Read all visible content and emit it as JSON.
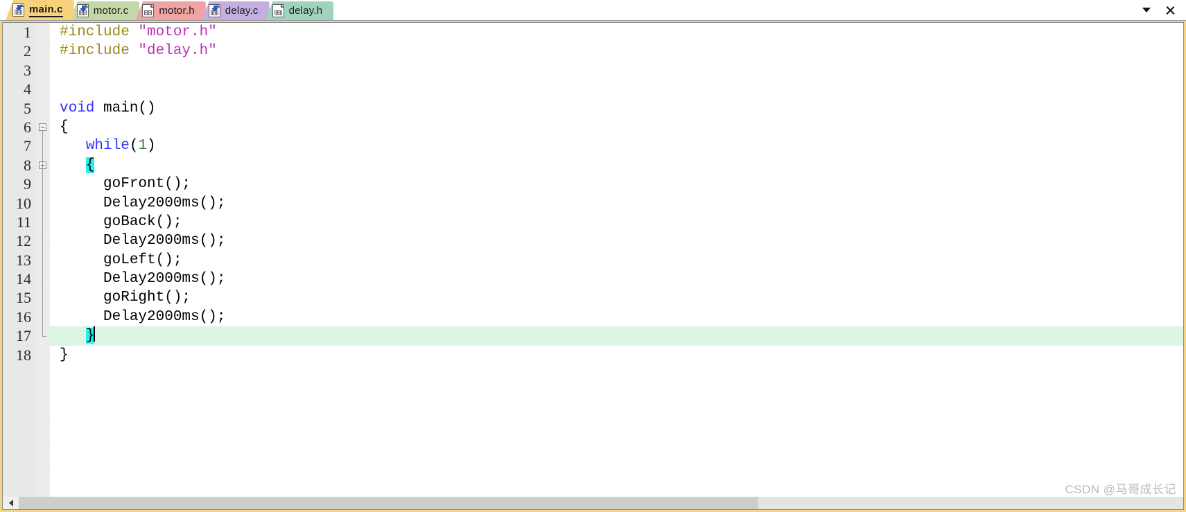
{
  "window": {
    "dropdown_icon": "chevron-down-icon",
    "close_icon": "close-icon"
  },
  "tabs": [
    {
      "label": "main.c",
      "icon": "c-file-icon",
      "active": true,
      "bg": "#f7d27a",
      "has_arrow": true
    },
    {
      "label": "motor.c",
      "icon": "c-file-icon",
      "active": false,
      "bg": "#c3d8a8",
      "has_arrow": true
    },
    {
      "label": "motor.h",
      "icon": "h-file-icon",
      "active": false,
      "bg": "#efa3a3",
      "has_arrow": false
    },
    {
      "label": "delay.c",
      "icon": "c-file-icon",
      "active": false,
      "bg": "#c4aee0",
      "has_arrow": true
    },
    {
      "label": "delay.h",
      "icon": "h-file-icon",
      "active": false,
      "bg": "#9fd3bd",
      "has_arrow": false
    }
  ],
  "editor": {
    "current_line": 17,
    "line_numbers": [
      1,
      2,
      3,
      4,
      5,
      6,
      7,
      8,
      9,
      10,
      11,
      12,
      13,
      14,
      15,
      16,
      17,
      18
    ],
    "lines": [
      {
        "n": 1,
        "tokens": [
          {
            "t": "#include ",
            "c": "tk-pre"
          },
          {
            "t": "\"motor.h\"",
            "c": "tk-str"
          }
        ]
      },
      {
        "n": 2,
        "tokens": [
          {
            "t": "#include ",
            "c": "tk-pre"
          },
          {
            "t": "\"delay.h\"",
            "c": "tk-str"
          }
        ]
      },
      {
        "n": 3,
        "tokens": []
      },
      {
        "n": 4,
        "tokens": []
      },
      {
        "n": 5,
        "tokens": [
          {
            "t": "void",
            "c": "tk-kw"
          },
          {
            "t": " main()",
            "c": "tk-plain"
          }
        ]
      },
      {
        "n": 6,
        "tokens": [
          {
            "t": "{",
            "c": "tk-brace"
          }
        ]
      },
      {
        "n": 7,
        "tokens": [
          {
            "t": "   ",
            "c": "tk-plain"
          },
          {
            "t": "while",
            "c": "tk-kw"
          },
          {
            "t": "(",
            "c": "tk-plain"
          },
          {
            "t": "1",
            "c": "tk-num"
          },
          {
            "t": ")",
            "c": "tk-plain"
          }
        ]
      },
      {
        "n": 8,
        "tokens": [
          {
            "t": "   ",
            "c": "tk-plain"
          },
          {
            "t": "{",
            "c": "hl-match"
          }
        ]
      },
      {
        "n": 9,
        "tokens": [
          {
            "t": "     goFront();",
            "c": "tk-plain"
          }
        ]
      },
      {
        "n": 10,
        "tokens": [
          {
            "t": "     Delay2000ms();",
            "c": "tk-plain"
          }
        ]
      },
      {
        "n": 11,
        "tokens": [
          {
            "t": "     goBack();",
            "c": "tk-plain"
          }
        ]
      },
      {
        "n": 12,
        "tokens": [
          {
            "t": "     Delay2000ms();",
            "c": "tk-plain"
          }
        ]
      },
      {
        "n": 13,
        "tokens": [
          {
            "t": "     goLeft();",
            "c": "tk-plain"
          }
        ]
      },
      {
        "n": 14,
        "tokens": [
          {
            "t": "     Delay2000ms();",
            "c": "tk-plain"
          }
        ]
      },
      {
        "n": 15,
        "tokens": [
          {
            "t": "     goRight();",
            "c": "tk-plain"
          }
        ]
      },
      {
        "n": 16,
        "tokens": [
          {
            "t": "     Delay2000ms();",
            "c": "tk-plain"
          }
        ]
      },
      {
        "n": 17,
        "tokens": [
          {
            "t": "   ",
            "c": "tk-plain"
          },
          {
            "t": "}",
            "c": "hl-match"
          },
          {
            "t": "",
            "c": "caret"
          }
        ]
      },
      {
        "n": 18,
        "tokens": [
          {
            "t": "}",
            "c": "tk-brace"
          }
        ]
      }
    ],
    "fold_markers": [
      {
        "line": 6,
        "type": "open"
      },
      {
        "line": 8,
        "type": "open"
      },
      {
        "line": 17,
        "type": "end"
      }
    ]
  },
  "scrollbar": {
    "left_arrow_icon": "scroll-left-arrow-icon",
    "thumb_percent": 63.5
  },
  "watermark": {
    "text": "CSDN @马哥成长记"
  }
}
